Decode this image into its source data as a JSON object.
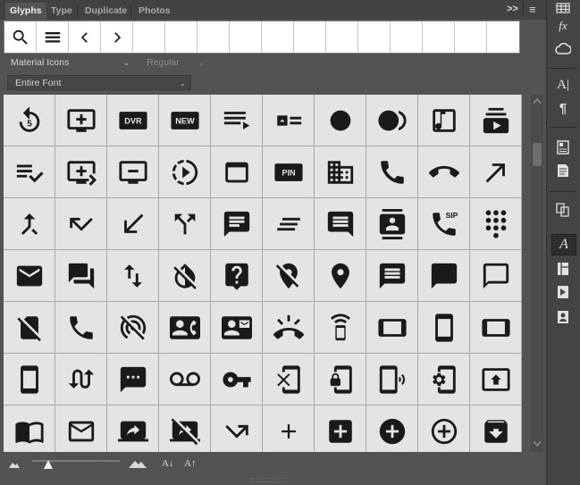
{
  "tabs": [
    {
      "label": "Glyphs",
      "active": true
    },
    {
      "label": "Type",
      "active": false
    },
    {
      "label": "Duplicate",
      "active": false
    },
    {
      "label": "Photos",
      "active": false
    }
  ],
  "header_icons": {
    "collapse": ">>",
    "menu": "≡"
  },
  "font_family": {
    "value": "Material Icons"
  },
  "font_style": {
    "value": "Regular"
  },
  "show_filter": {
    "value": "Entire Font"
  },
  "glyph_icons": [
    [
      "replay-5-icon",
      "add-to-queue-icon",
      "dvr-icon",
      "fiber-new-icon",
      "playlist-play-icon",
      "featured-play-list-icon",
      "fiber-manual-record-icon",
      "fiber-smart-record-icon",
      "music-video-icon",
      "subscriptions-icon"
    ],
    [
      "playlist-add-check-icon",
      "queue-play-next-icon",
      "remove-from-queue-icon",
      "slow-motion-video-icon",
      "web-asset-icon",
      "fiber-pin-icon",
      "business-icon",
      "call-icon",
      "call-end-icon",
      "call-made-icon"
    ],
    [
      "call-merge-icon",
      "call-missed-icon",
      "call-received-icon",
      "call-split-icon",
      "chat-icon",
      "clear-all-icon",
      "comment-icon",
      "contacts-icon",
      "dialer-sip-icon",
      "dialpad-icon"
    ],
    [
      "email-icon",
      "forum-icon",
      "import-export-icon",
      "invert-colors-off-icon",
      "live-help-icon",
      "location-off-icon",
      "location-on-icon",
      "message-icon",
      "chat-bubble-icon",
      "chat-bubble-outline-icon"
    ],
    [
      "no-sim-icon",
      "phone-icon",
      "portable-wifi-off-icon",
      "contact-phone-icon",
      "contact-mail-icon",
      "ring-volume-icon",
      "speaker-phone-icon",
      "stay-current-landscape-icon",
      "stay-current-portrait-icon",
      "stay-primary-landscape-icon"
    ],
    [
      "stay-primary-portrait-icon",
      "swap-calls-icon",
      "textsms-icon",
      "voicemail-icon",
      "vpn-key-icon",
      "phonelink-erase-icon",
      "phonelink-lock-icon",
      "phonelink-ring-icon",
      "phonelink-setup-icon",
      "present-to-all-icon"
    ],
    [
      "import-contacts-icon",
      "mail-outline-icon",
      "screen-share-icon",
      "stop-screen-share-icon",
      "call-missed-outgoing-icon",
      "add-icon",
      "add-box-icon",
      "add-circle-icon",
      "add-circle-outline-icon",
      "archive-icon"
    ]
  ],
  "glyph_texts": {
    "dvr": "DVR",
    "new": "NEW",
    "pin": "PIN",
    "sip": "SIP",
    "replay": "5"
  },
  "colors": {
    "glyph": "#1a1a1a",
    "panel": "#535353",
    "cell_bg": "#e4e4e4"
  }
}
